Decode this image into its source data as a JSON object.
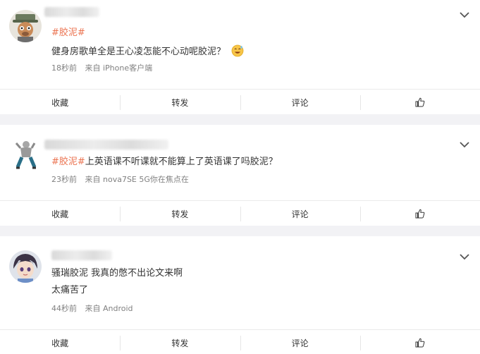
{
  "posts": [
    {
      "topic": "#胶泥#",
      "text": "健身房歌单全是王心凌怎能不心动呢胶泥？",
      "time": "18秒前",
      "source": "来自 iPhone客户端",
      "actions": [
        "收藏",
        "转发",
        "评论"
      ],
      "emoji": "grinning-emoji"
    },
    {
      "topic": "#胶泥#",
      "text": "上英语课不听课就不能算上了英语课了吗胶泥？",
      "time": "23秒前",
      "source": "来自 nova7SE 5G你在焦点在",
      "actions": [
        "收藏",
        "转发",
        "评论"
      ]
    },
    {
      "line1": "骚瑞胶泥 我真的憋不出论文来啊",
      "line2": "太痛苦了",
      "time": "44秒前",
      "source": "来自 Android",
      "actions": [
        "收藏",
        "转发",
        "评论"
      ]
    }
  ],
  "accent_color": "#eb7350"
}
